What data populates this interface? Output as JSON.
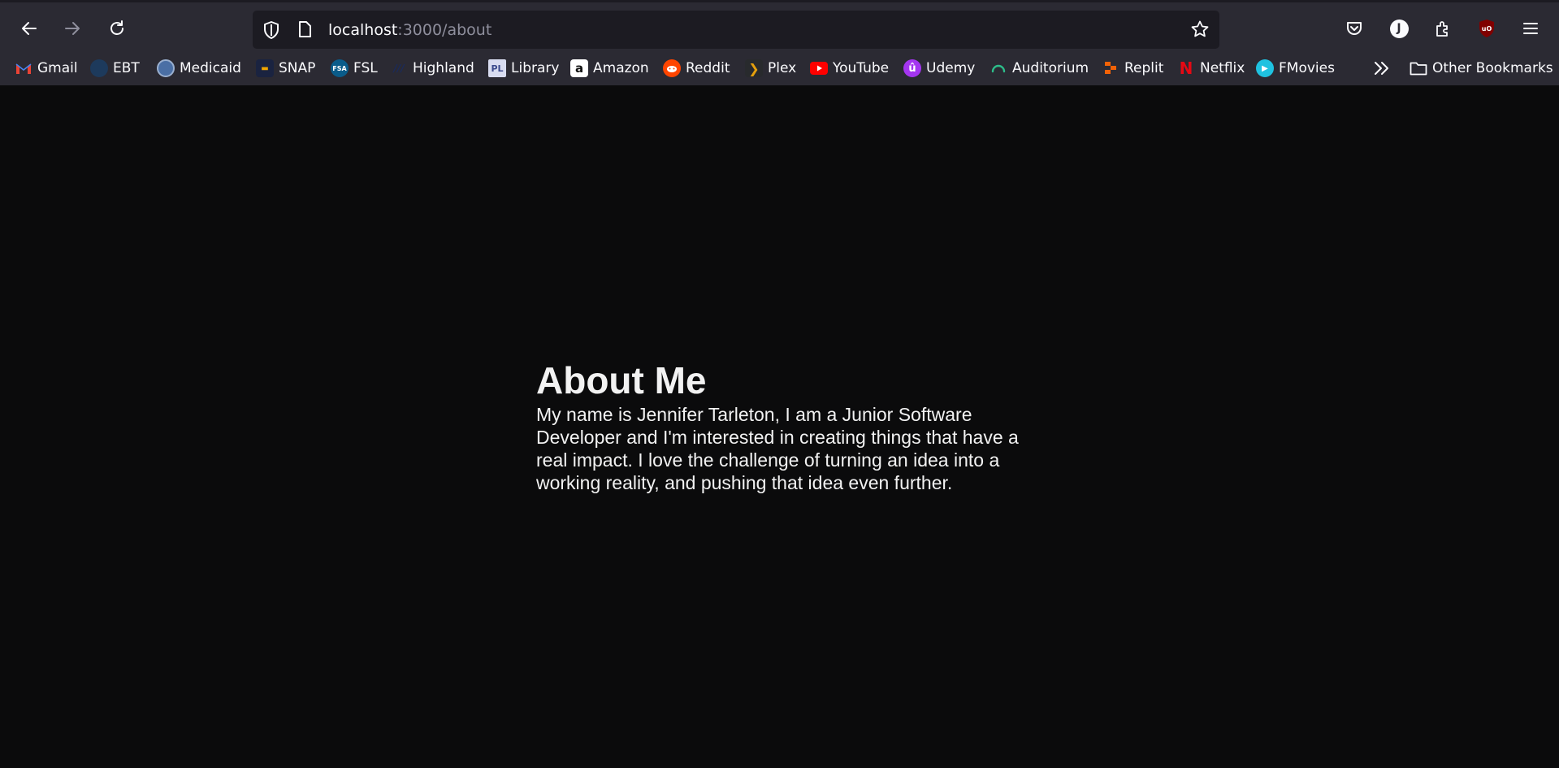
{
  "browser": {
    "url_host": "localhost",
    "url_rest": ":3000/about",
    "profile_initial": "J",
    "bookmarks": [
      {
        "label": "Gmail",
        "icon": "gmail-icon",
        "color": "#ea4335"
      },
      {
        "label": "EBT",
        "icon": "ebt-icon",
        "color": "#1d3a5c"
      },
      {
        "label": "Medicaid",
        "icon": "medicaid-icon",
        "color": "#4a6fa5"
      },
      {
        "label": "SNAP",
        "icon": "snap-icon",
        "color": "#f0a500"
      },
      {
        "label": "FSL",
        "icon": "fsl-icon",
        "color": "#0a5c8a"
      },
      {
        "label": "Highland",
        "icon": "highland-icon",
        "color": "#1a2a5c"
      },
      {
        "label": "Library",
        "icon": "library-icon",
        "color": "#3b4a8c"
      },
      {
        "label": "Amazon",
        "icon": "amazon-icon",
        "color": "#ffffff"
      },
      {
        "label": "Reddit",
        "icon": "reddit-icon",
        "color": "#ff4500"
      },
      {
        "label": "Plex",
        "icon": "plex-icon",
        "color": "#e5a00d"
      },
      {
        "label": "YouTube",
        "icon": "youtube-icon",
        "color": "#ff0000"
      },
      {
        "label": "Udemy",
        "icon": "udemy-icon",
        "color": "#a435f0"
      },
      {
        "label": "Auditorium",
        "icon": "auditorium-icon",
        "color": "#2dbd8a"
      },
      {
        "label": "Replit",
        "icon": "replit-icon",
        "color": "#f26207"
      },
      {
        "label": "Netflix",
        "icon": "netflix-icon",
        "color": "#e50914"
      },
      {
        "label": "FMovies",
        "icon": "fmovies-icon",
        "color": "#1fc2e0"
      }
    ],
    "other_bookmarks": "Other Bookmarks"
  },
  "page": {
    "title": "About Me",
    "body": "My name is Jennifer Tarleton, I am a Junior Software Developer and I'm interested in creating things that have a real impact. I love the challenge of turning an idea into a working reality, and pushing that idea even further."
  }
}
